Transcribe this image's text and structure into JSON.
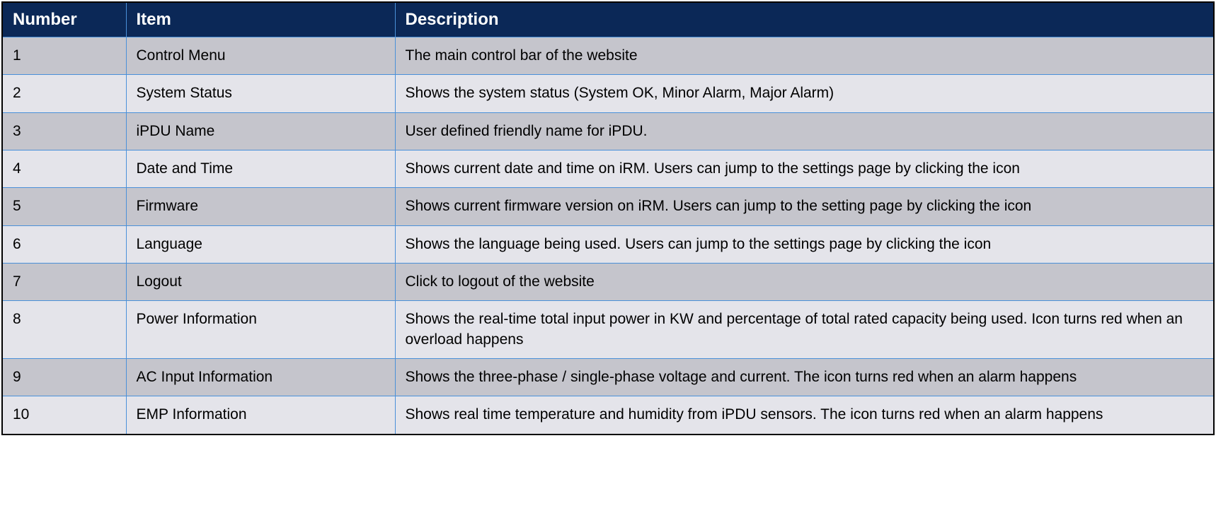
{
  "headers": {
    "number": "Number",
    "item": "Item",
    "description": "Description"
  },
  "rows": [
    {
      "number": "1",
      "item": "Control Menu",
      "description": "The main control bar of the website"
    },
    {
      "number": "2",
      "item": "System Status",
      "description": "Shows the system status (System OK, Minor Alarm, Major Alarm)"
    },
    {
      "number": "3",
      "item": "iPDU Name",
      "description": "User defined friendly name for iPDU."
    },
    {
      "number": "4",
      "item": "Date and Time",
      "description": "Shows current date and time on iRM. Users can jump to the settings page by clicking the icon"
    },
    {
      "number": "5",
      "item": "Firmware",
      "description": "Shows current firmware version on iRM. Users can jump to the setting page by clicking the icon"
    },
    {
      "number": "6",
      "item": "Language",
      "description": "Shows the language being used. Users can jump to the settings page by clicking the icon"
    },
    {
      "number": "7",
      "item": "Logout",
      "description": "Click to logout of the website"
    },
    {
      "number": "8",
      "item": "Power Information",
      "description": "Shows the real-time total input power in KW and percentage of total rated capacity being used. Icon turns red when an overload happens"
    },
    {
      "number": "9",
      "item": "AC Input Information",
      "description": "Shows the three-phase / single-phase voltage and current. The icon turns red when an alarm happens"
    },
    {
      "number": "10",
      "item": "EMP Information",
      "description": "Shows real time temperature and humidity from iPDU sensors. The icon turns red when an alarm happens"
    }
  ]
}
